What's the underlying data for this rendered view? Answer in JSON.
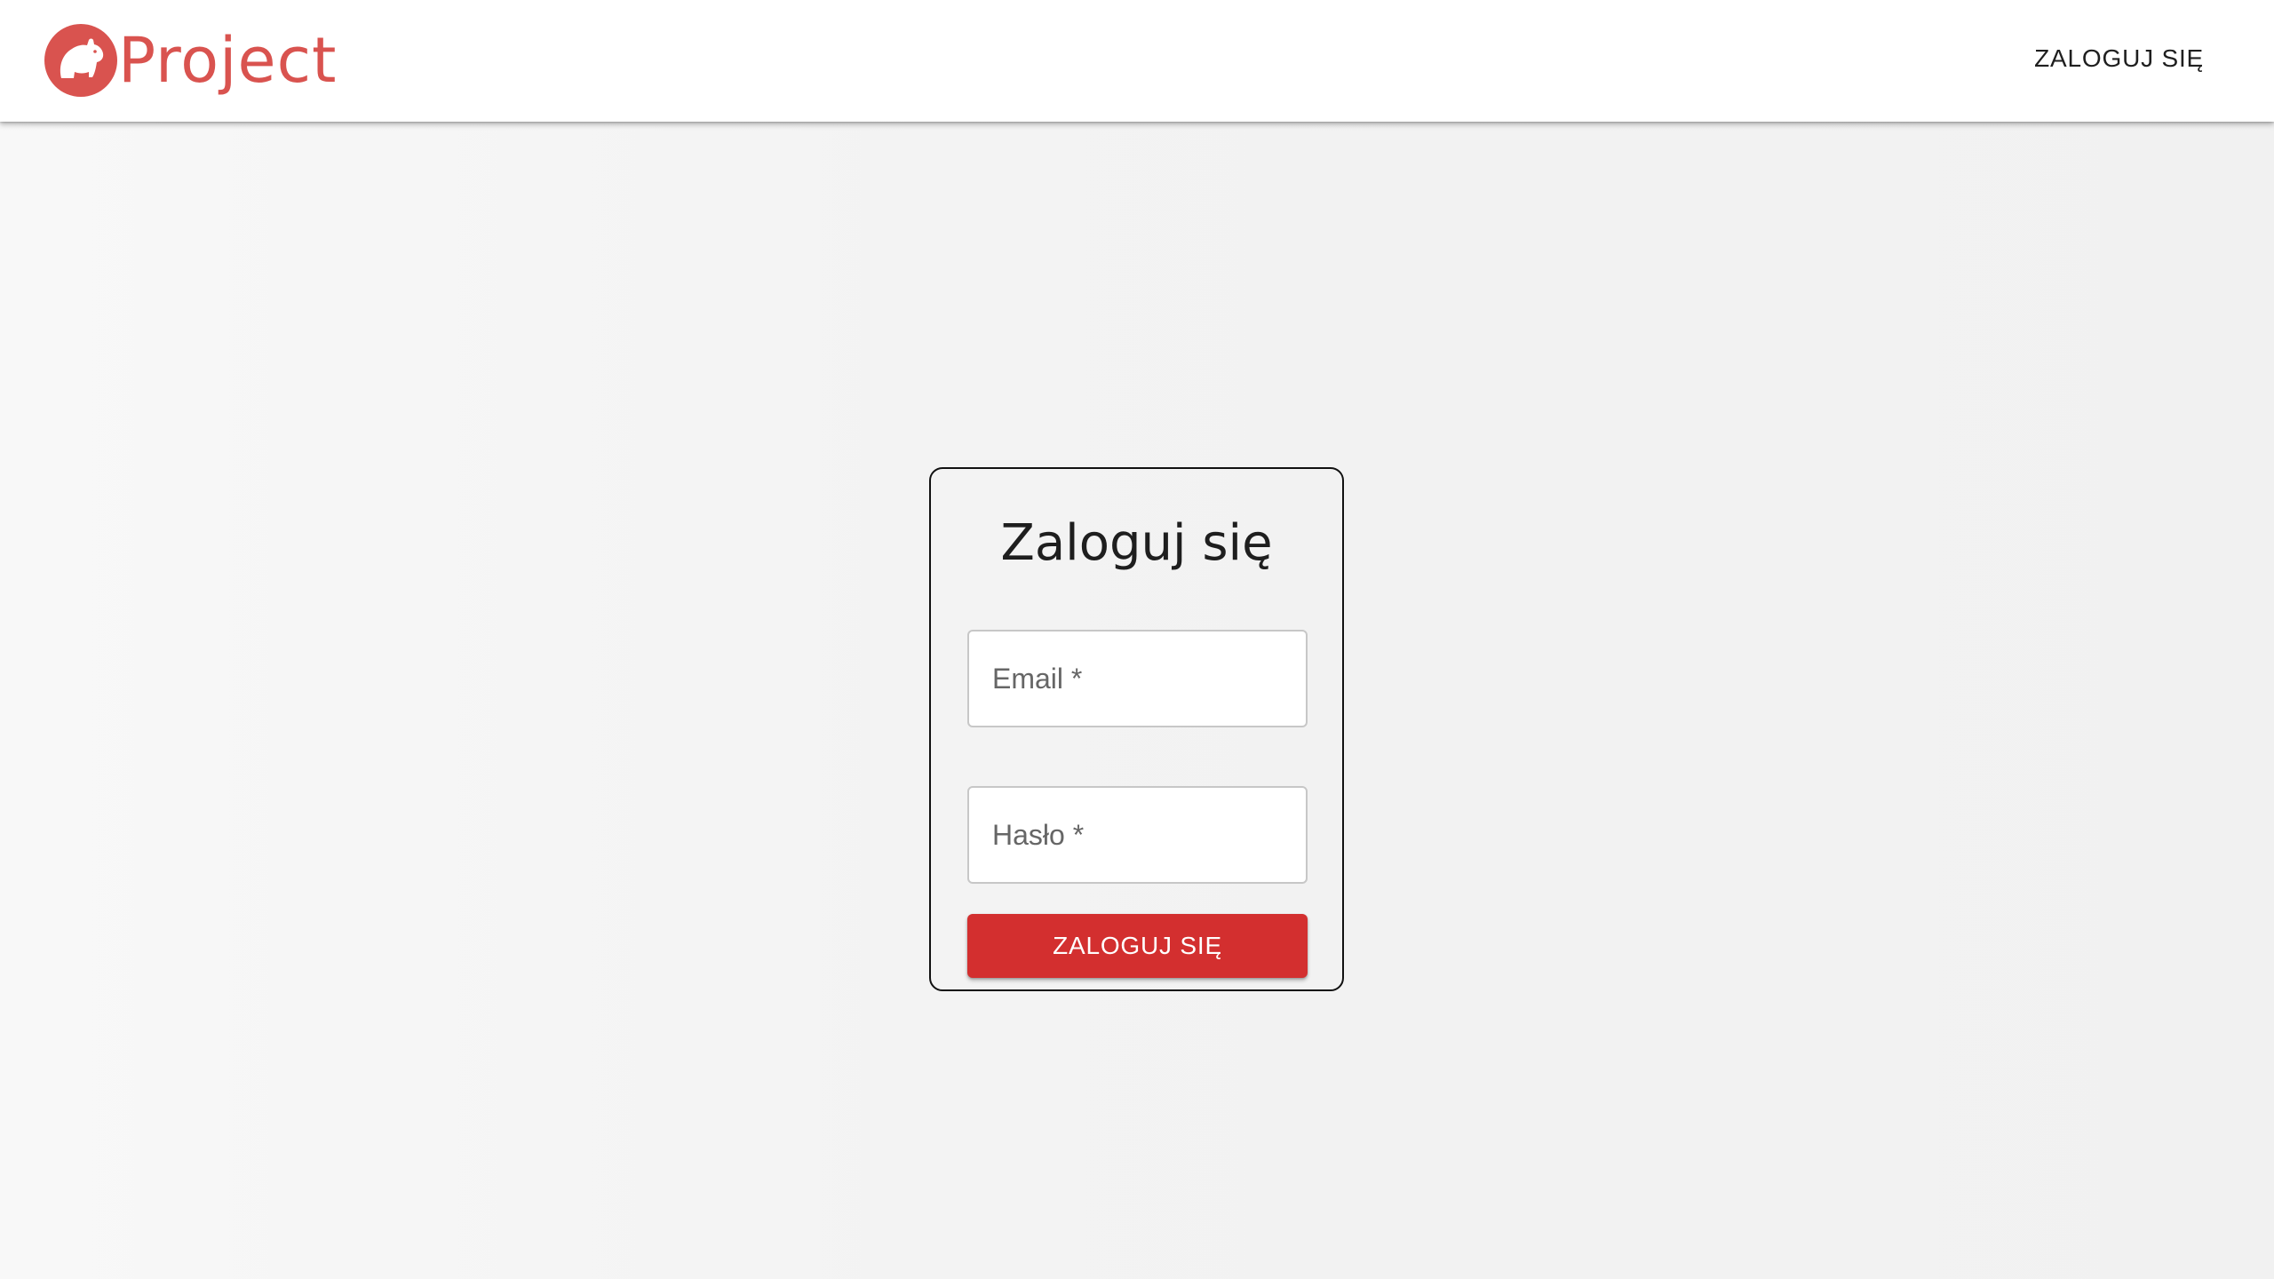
{
  "header": {
    "logo_text": "Project",
    "logo_icon": "capybara-logo-icon",
    "login_link": "ZALOGUJ SIĘ"
  },
  "login_form": {
    "title": "Zaloguj się",
    "email": {
      "placeholder": "Email *",
      "value": ""
    },
    "password": {
      "placeholder": "Hasło *",
      "value": ""
    },
    "submit_label": "ZALOGUJ SIĘ"
  },
  "colors": {
    "brand": "#d9534f",
    "primary_button": "#d32f2f",
    "background": "#f3f3f3",
    "appbar": "#ffffff"
  }
}
